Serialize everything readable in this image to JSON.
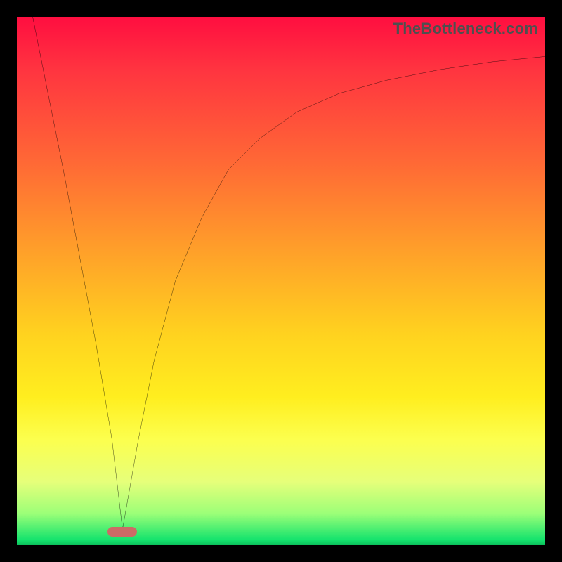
{
  "watermark": "TheBottleneck.com",
  "colors": {
    "frame": "#000000",
    "gradient_top": "#ff0e40",
    "gradient_bottom": "#0cbf5b",
    "curve": "#000000",
    "marker": "#cc6b66",
    "watermark": "#4f4f4f"
  },
  "chart_data": {
    "type": "line",
    "title": "",
    "xlabel": "",
    "ylabel": "",
    "xlim": [
      0,
      100
    ],
    "ylim": [
      0,
      100
    ],
    "grid": false,
    "legend_position": "none",
    "series": [
      {
        "name": "left-leg",
        "x": [
          3,
          6,
          9,
          12,
          15,
          18,
          20
        ],
        "values": [
          100,
          85,
          70,
          54,
          38,
          20,
          3
        ]
      },
      {
        "name": "right-curve",
        "x": [
          20,
          23,
          26,
          30,
          35,
          40,
          46,
          53,
          61,
          70,
          80,
          90,
          100
        ],
        "values": [
          3,
          20,
          35,
          50,
          62,
          71,
          77,
          82,
          85.5,
          88,
          90,
          91.5,
          92.5
        ]
      }
    ],
    "annotations": [
      {
        "name": "valley-marker",
        "x": 20,
        "y": 2.5,
        "shape": "pill",
        "color": "#cc6b66"
      }
    ]
  }
}
